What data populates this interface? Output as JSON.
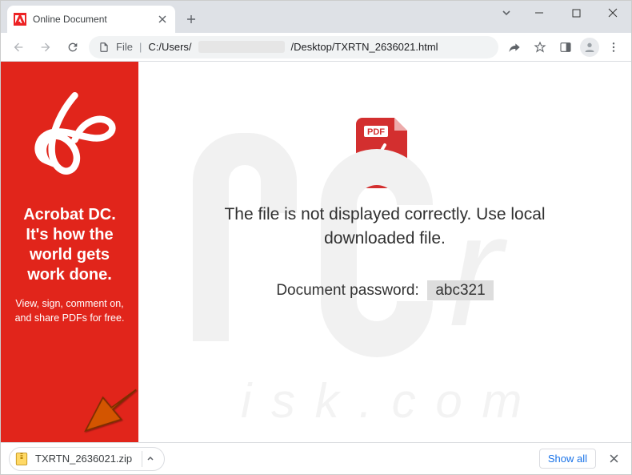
{
  "tab": {
    "title": "Online Document"
  },
  "address": {
    "scheme": "File",
    "prefix": "C:/Users/",
    "suffix": "/Desktop/TXRTN_2636021.html"
  },
  "sidebar": {
    "headline": "Acrobat DC. It's how the world gets work done.",
    "sub": "View, sign, comment on, and share PDFs for free."
  },
  "main": {
    "pdf_label": "PDF",
    "message": "The file is not displayed correctly. Use local downloaded file.",
    "pw_label": "Document password:",
    "pw_value": "abc321"
  },
  "download": {
    "filename": "TXRTN_2636021.zip",
    "showall": "Show all"
  },
  "icons": {
    "adobe": "adobe-logo-icon",
    "pdf": "pdf-file-icon",
    "zip": "zip-file-icon"
  }
}
